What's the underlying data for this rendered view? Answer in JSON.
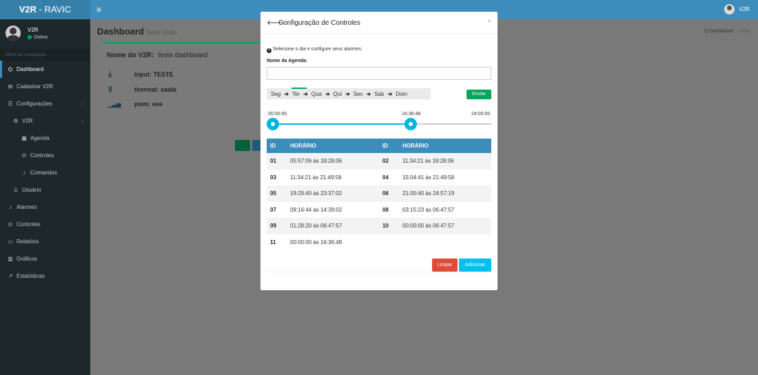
{
  "app": {
    "logo_bold": "V2R",
    "logo_rest": " - RAVIC",
    "menu_icon": "hamburger-icon",
    "user_name": "V2R"
  },
  "sidebar": {
    "user": {
      "name": "V2R",
      "status": "Online"
    },
    "header": "Menu de navegação",
    "items": [
      {
        "label": "Dashboard",
        "icon": "dashboard-icon",
        "glyph": "⛭"
      },
      {
        "label": "Cadastrar V2R",
        "icon": "plus-square-icon",
        "glyph": "⊞"
      },
      {
        "label": "Configurações",
        "icon": "list-icon",
        "glyph": "☰"
      },
      {
        "label": "V2R",
        "icon": "gear-icon",
        "glyph": "⚙"
      },
      {
        "label": "Agenda",
        "icon": "calendar-icon",
        "glyph": "▦"
      },
      {
        "label": "Controles",
        "icon": "gamepad-icon",
        "glyph": "⊙"
      },
      {
        "label": "Comandos",
        "icon": "bell-icon",
        "glyph": "♪"
      },
      {
        "label": "Usuário",
        "icon": "user-icon",
        "glyph": "♙"
      },
      {
        "label": "Alarmes",
        "icon": "bell-icon",
        "glyph": "♪"
      },
      {
        "label": "Controles",
        "icon": "gamepad-icon",
        "glyph": "⊙"
      },
      {
        "label": "Relatório",
        "icon": "file-icon",
        "glyph": "▭"
      },
      {
        "label": "Gráficos",
        "icon": "bar-chart-icon",
        "glyph": "▥"
      },
      {
        "label": "Estatísticas",
        "icon": "line-chart-icon",
        "glyph": "↗"
      }
    ]
  },
  "content": {
    "title": "Dashboard",
    "subtitle": "Bem Vindo",
    "breadcrumb": {
      "home": "Dashboard",
      "current": "Aovi"
    }
  },
  "dashboard": {
    "name_label": "Nome do V2R:",
    "name_value": "teste dashboard",
    "rows": [
      {
        "label": "input: TESTE",
        "icon": "download-icon",
        "glyph": "⤓"
      },
      {
        "label": "thermal: saida",
        "icon": "thermometer-icon",
        "glyph": "🌡"
      },
      {
        "label": "pwm: eee",
        "icon": "signal-icon",
        "glyph": "▁▃▅"
      }
    ]
  },
  "modal": {
    "title": "Configuração de Controles",
    "close": "×",
    "info": "Selecione o dia e configure seus alarmes.",
    "agenda_label": "Nome da Agenda:",
    "agenda_value": "",
    "days": [
      "Seg",
      "Ter",
      "Qua",
      "Qui",
      "Sex",
      "Sab",
      "Dom"
    ],
    "selected_day": "Ter",
    "send_label": "Enviar",
    "slider": {
      "min_label": "00:00:00",
      "value_label": "16:36:48",
      "max_label": "24:00:00",
      "value_fraction": 0.6922
    },
    "table": {
      "headers": [
        "ID",
        "HORÁRIO",
        "ID",
        "HORÁRIO"
      ],
      "rows": [
        [
          "01",
          "05:57:06 às 18:28:06",
          "02",
          "11:34:21 às 18:28:06"
        ],
        [
          "03",
          "11:34:21 às 21:49:58",
          "04",
          "15:04:41 às 21:49:58"
        ],
        [
          "05",
          "19:29:40 às 23:37:02",
          "06",
          "21:00:40 às 24:57:19"
        ],
        [
          "07",
          "09:16:44 às 14:39:02",
          "08",
          "03:15:23 às 06:47:57"
        ],
        [
          "09",
          "01:28:20 às 06:47:57",
          "10",
          "00:00:00 às 06:47:57"
        ],
        [
          "11",
          "00:00:00 às 16:36:48",
          "",
          ""
        ]
      ]
    },
    "clear_label": "Limpar",
    "add_label": "Adicionar"
  },
  "colors": {
    "header": "#3c8dbc",
    "success": "#00a65a",
    "danger": "#dd4b39",
    "info": "#00c0ef"
  }
}
